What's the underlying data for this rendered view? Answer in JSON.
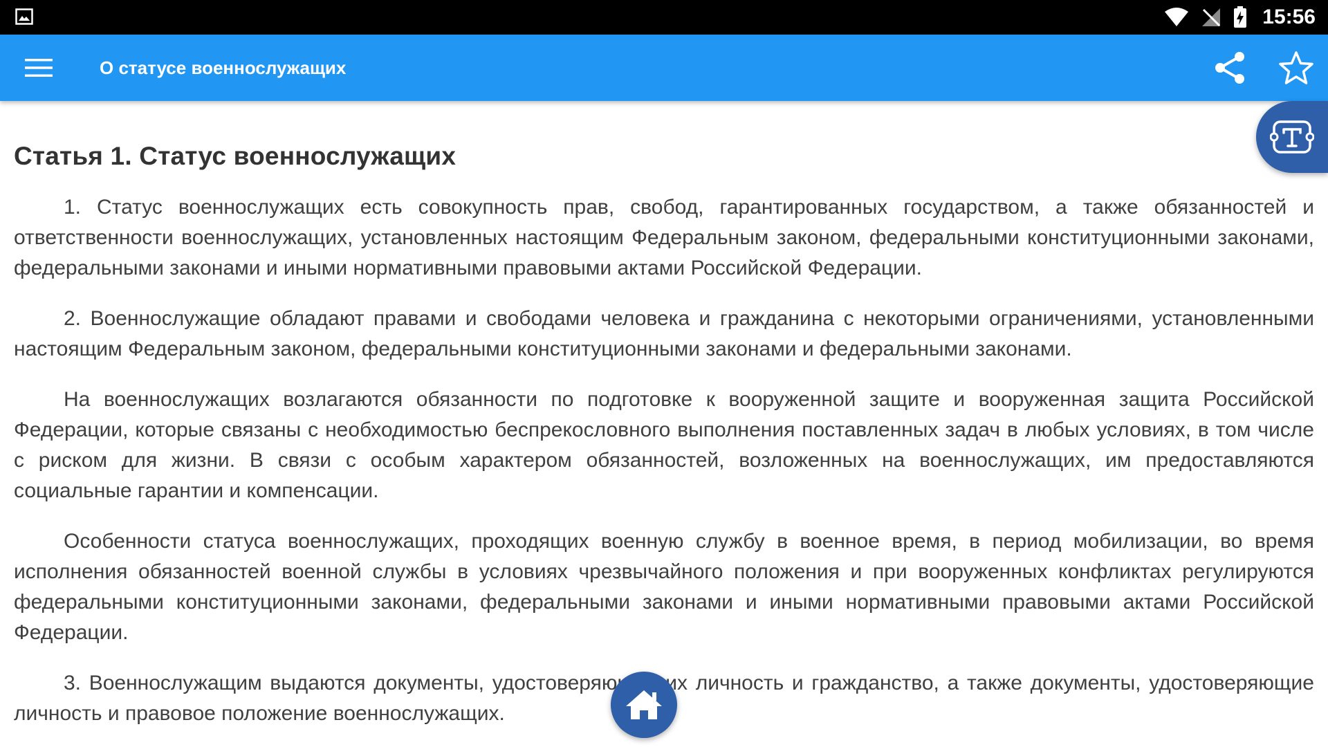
{
  "status_bar": {
    "time": "15:56",
    "icons": [
      "gallery-icon",
      "wifi-icon",
      "no-signal-icon",
      "battery-charging-icon"
    ]
  },
  "app_bar": {
    "title": "О статусе военнослужащих",
    "menu_icon": "menu-icon",
    "share_icon": "share-icon",
    "favorite_icon": "star-outline-icon",
    "color": "#2196F3"
  },
  "article": {
    "title": "Статья 1. Статус военнослужащих",
    "paragraphs": [
      "1. Статус военнослужащих есть совокупность прав, свобод, гарантированных государством, а также обязанностей и ответственности военнослужащих, установленных настоящим Федеральным законом, федеральными конституционными законами, федеральными законами и иными нормативными правовыми актами Российской Федерации.",
      "2. Военнослужащие обладают правами и свободами человека и гражданина с некоторыми ограничениями, установленными настоящим Федеральным законом, федеральными конституционными законами и федеральными законами.",
      "На военнослужащих возлагаются обязанности по подготовке к вооруженной защите и вооруженная защита Российской Федерации, которые связаны с необходимостью беспрекословного выполнения поставленных задач в любых условиях, в том числе с риском для жизни. В связи с особым характером обязанностей, возложенных на военнослужащих, им предоставляются социальные гарантии и компенсации.",
      "Особенности статуса военнослужащих, проходящих военную службу в военное время, в период мобилизации, во время исполнения обязанностей военной службы в условиях чрезвычайного положения и при вооруженных конфликтах регулируются федеральными конституционными законами, федеральными законами и иными нормативными правовыми актами Российской Федерации.",
      "3. Военнослужащим выдаются документы, удостоверяющие их личность и гражданство, а также документы, удостоверяющие личность и правовое положение военнослужащих."
    ]
  },
  "floating": {
    "font_size_icon": "text-size-icon",
    "home_icon": "home-icon",
    "fab_color": "#2f5fa8"
  }
}
